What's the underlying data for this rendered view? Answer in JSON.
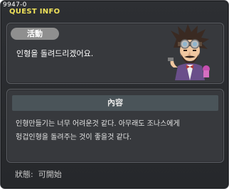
{
  "window": {
    "quest_id": "9947-0",
    "title": "QUEST INFO"
  },
  "activity": {
    "tag": "活動",
    "message": "인형을 돌려드리겠어요."
  },
  "npc": {
    "icon": "goggles-old-man-npc-icon"
  },
  "content": {
    "header": "內容",
    "lines": [
      "인형만들기는 너무 어려운것 같다. 아무래도 조나스에게",
      "헝겁인형을 돌려주는 것이 좋을것 같다."
    ]
  },
  "status": {
    "label": "狀態:",
    "value": "可開始"
  },
  "colors": {
    "title": "#f0e25a",
    "panel_bg": "#37393d",
    "header_bg": "#4a5459",
    "pill_bg": "#8f8f8f"
  }
}
